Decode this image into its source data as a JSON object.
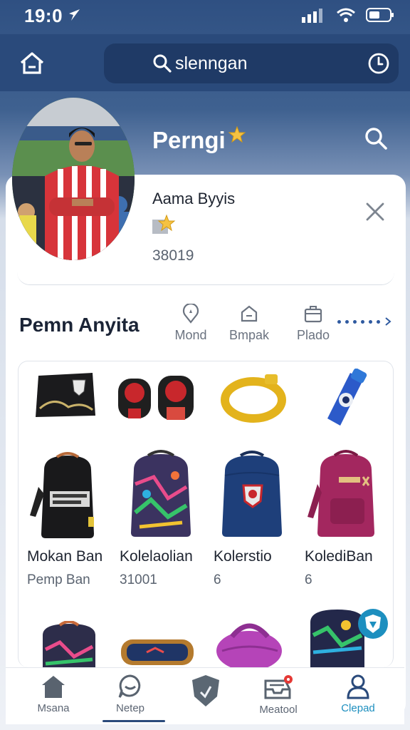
{
  "status_bar": {
    "time": "19:0"
  },
  "header": {
    "search_value": "slenngan"
  },
  "profile": {
    "title": "Perngi",
    "name": "Aama Byyis",
    "count": "38019"
  },
  "section": {
    "title": "Pemn Anyita",
    "tabs": [
      {
        "label": "Mond",
        "icon": "location-pin-icon"
      },
      {
        "label": "Bmpak",
        "icon": "shop-icon"
      },
      {
        "label": "Plado",
        "icon": "briefcase-icon"
      }
    ]
  },
  "items": [
    {
      "icon": "black-bag-icon"
    },
    {
      "icon": "shin-guards-icon"
    },
    {
      "icon": "yellow-collar-icon"
    },
    {
      "icon": "water-bottle-icon"
    },
    {
      "icon": "black-backpack-icon",
      "label": "Mokan Ban",
      "sub": "Pemp Ban"
    },
    {
      "icon": "graffiti-backpack-icon",
      "label": "Kolelaolian",
      "sub": "31001"
    },
    {
      "icon": "blue-backpack-icon",
      "label": "Kolerstio",
      "sub": "6"
    },
    {
      "icon": "pink-backpack-icon",
      "label": "KolediBan",
      "sub": "6"
    },
    {
      "icon": "graffiti-bag-icon"
    },
    {
      "icon": "pencil-case-icon"
    },
    {
      "icon": "purple-bag-icon"
    },
    {
      "icon": "graffiti-backpack-2-icon"
    }
  ],
  "bottom_nav": [
    {
      "label": "Msana",
      "icon": "home-icon"
    },
    {
      "label": "Netep",
      "icon": "chat-icon"
    },
    {
      "label": "",
      "icon": "shield-icon"
    },
    {
      "label": "Meatool",
      "icon": "inbox-icon"
    },
    {
      "label": "Clepad",
      "icon": "profile-icon"
    }
  ],
  "colors": {
    "header": "#2a4a7b",
    "accent": "#1d8fbf",
    "badge": "#e53935"
  }
}
